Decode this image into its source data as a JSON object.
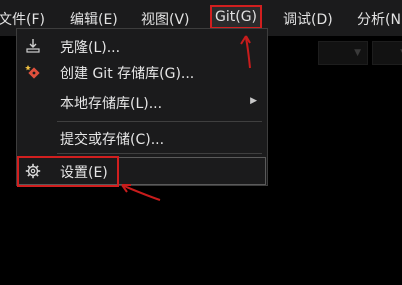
{
  "menubar": {
    "items": [
      {
        "label": "文件(F)"
      },
      {
        "label": "编辑(E)"
      },
      {
        "label": "视图(V)"
      },
      {
        "label": "Git(G)"
      },
      {
        "label": "调试(D)"
      },
      {
        "label": "分析(N"
      }
    ]
  },
  "git_menu": {
    "items": [
      {
        "label": "克隆(L)...",
        "icon": "download-icon"
      },
      {
        "label": "创建 Git 存储库(G)...",
        "icon": "git-diamond-icon"
      },
      {
        "label": "本地存储库(L)...",
        "icon": "",
        "submenu": true
      },
      {
        "label": "提交或存储(C)...",
        "icon": ""
      },
      {
        "label": "设置(E)",
        "icon": "gear-icon",
        "highlighted": true
      }
    ]
  },
  "colors": {
    "accent_annotation": "#d11f1f",
    "menu_bg": "#1b1b1c",
    "page_bg": "#000000"
  }
}
